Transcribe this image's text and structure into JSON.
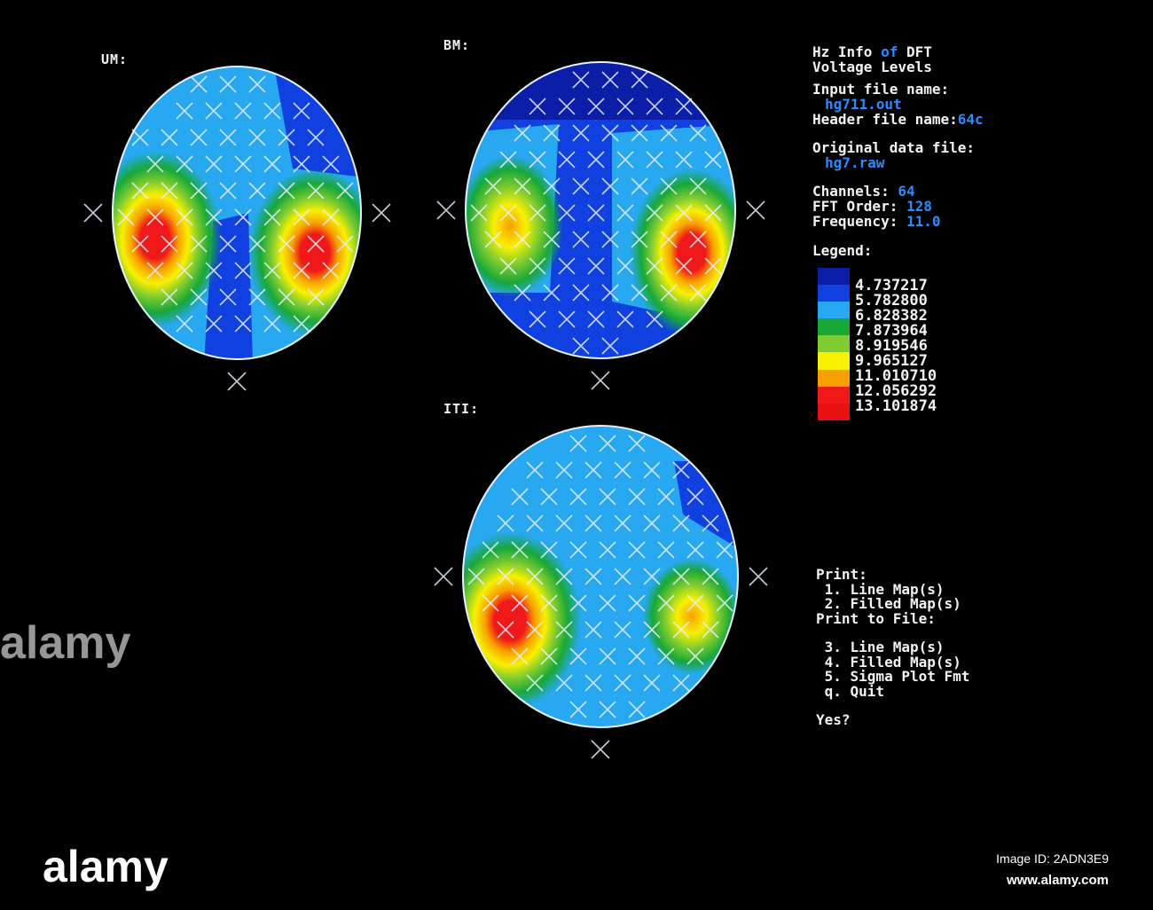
{
  "maps": [
    {
      "label": "UM:"
    },
    {
      "label": "BM:"
    },
    {
      "label": "ITI:"
    }
  ],
  "info": {
    "title_1": "Hz Info ",
    "title_of": "of",
    "title_2": " DFT",
    "title_3": "Voltage Levels",
    "input_label": "Input file name:",
    "input_value": "hg711.out",
    "header_label": "Header file name:",
    "header_value": "64c",
    "original_label": "Original data file:",
    "original_value": "hg7.raw",
    "channels_label": "Channels: ",
    "channels_value": "64",
    "fft_label": "FFT Order: ",
    "fft_value": "128",
    "freq_label": "Frequency: ",
    "freq_value": "11.0"
  },
  "legend": {
    "title": "Legend:",
    "colors": [
      "#0a1ea8",
      "#1040e0",
      "#28a8f0",
      "#18a838",
      "#80cc30",
      "#f8f000",
      "#f8a000",
      "#f01818",
      "#e81010"
    ],
    "values": [
      "4.737217",
      "5.782800",
      "6.828382",
      "7.873964",
      "8.919546",
      "9.965127",
      "11.010710",
      "12.056292",
      "13.101874"
    ]
  },
  "menu": {
    "print": "Print:",
    "items_a": [
      " 1. Line Map(s)",
      " 2. Filled Map(s)"
    ],
    "print_file": "Print to File:",
    "items_b": [
      " 3. Line Map(s)",
      " 4. Filled Map(s)",
      " 5. Sigma Plot Fmt",
      " q. Quit"
    ],
    "prompt": "Yes?"
  },
  "watermark": {
    "brand": "alamy",
    "image_id": "Image ID: 2ADN3E9",
    "url": "www.alamy.com"
  }
}
